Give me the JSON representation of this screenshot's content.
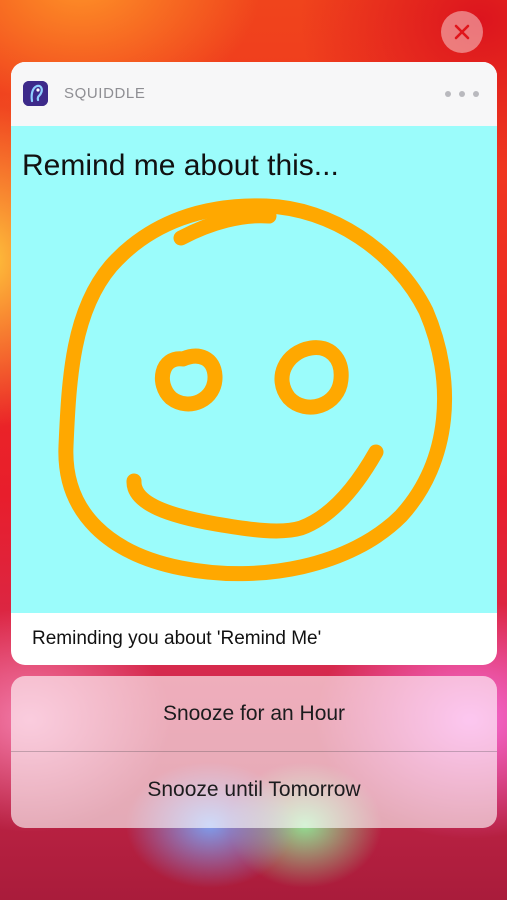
{
  "notification": {
    "app_name": "SQUIDDLE",
    "app_icon": "squiddle-app-icon",
    "more_icon": "ellipsis-icon",
    "close_icon": "close-icon",
    "drawing": {
      "title": "Remind me about this...",
      "background_color": "#9bfcfb",
      "stroke_color": "#ffa800",
      "content": "smiley-face-sketch"
    },
    "body": "Reminding you about 'Remind Me'"
  },
  "actions": [
    {
      "label": "Snooze for an Hour"
    },
    {
      "label": "Snooze until Tomorrow"
    }
  ],
  "colors": {
    "close_x": "#e0151b",
    "app_name": "#8e8e93"
  }
}
